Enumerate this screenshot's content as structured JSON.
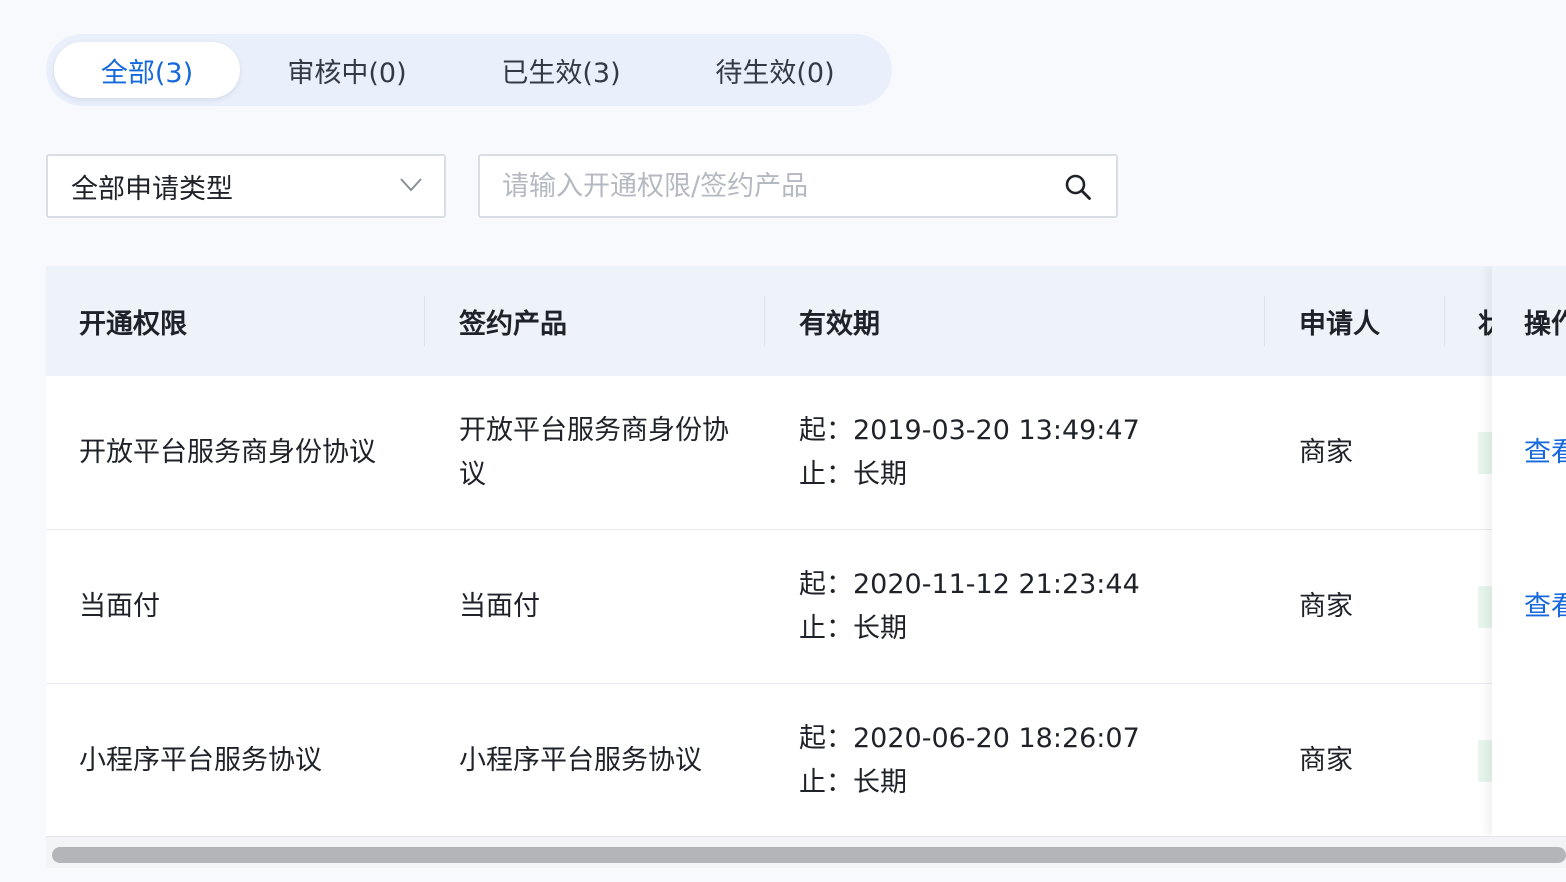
{
  "tabs": [
    {
      "label": "全部(3)",
      "active": true
    },
    {
      "label": "审核中(0)",
      "active": false
    },
    {
      "label": "已生效(3)",
      "active": false
    },
    {
      "label": "待生效(0)",
      "active": false
    }
  ],
  "filters": {
    "type_select_value": "全部申请类型",
    "search_placeholder": "请输入开通权限/签约产品"
  },
  "table": {
    "headers": {
      "permission": "开通权限",
      "product": "签约产品",
      "validity": "有效期",
      "applicant": "申请人",
      "status": "状",
      "operation": "操作"
    },
    "rows": [
      {
        "permission": "开放平台服务商身份协议",
        "product": "开放平台服务商身份协议",
        "start": "起：2019-03-20 13:49:47",
        "end": "止：长期",
        "applicant": "商家",
        "action": "查看"
      },
      {
        "permission": "当面付",
        "product": "当面付",
        "start": "起：2020-11-12 21:23:44",
        "end": "止：长期",
        "applicant": "商家",
        "action": "查看"
      },
      {
        "permission": "小程序平台服务协议",
        "product": "小程序平台服务协议",
        "start": "起：2020-06-20 18:26:07",
        "end": "止：长期",
        "applicant": "商家",
        "action": ""
      }
    ]
  },
  "icons": {
    "select_arrow": "chevron-down-icon",
    "search": "search-icon"
  },
  "colors": {
    "accent": "#1668dc",
    "tab_bar_bg": "#eaf0fb",
    "table_header_bg": "#eef2f9",
    "status_bg": "#e6f6ec"
  }
}
